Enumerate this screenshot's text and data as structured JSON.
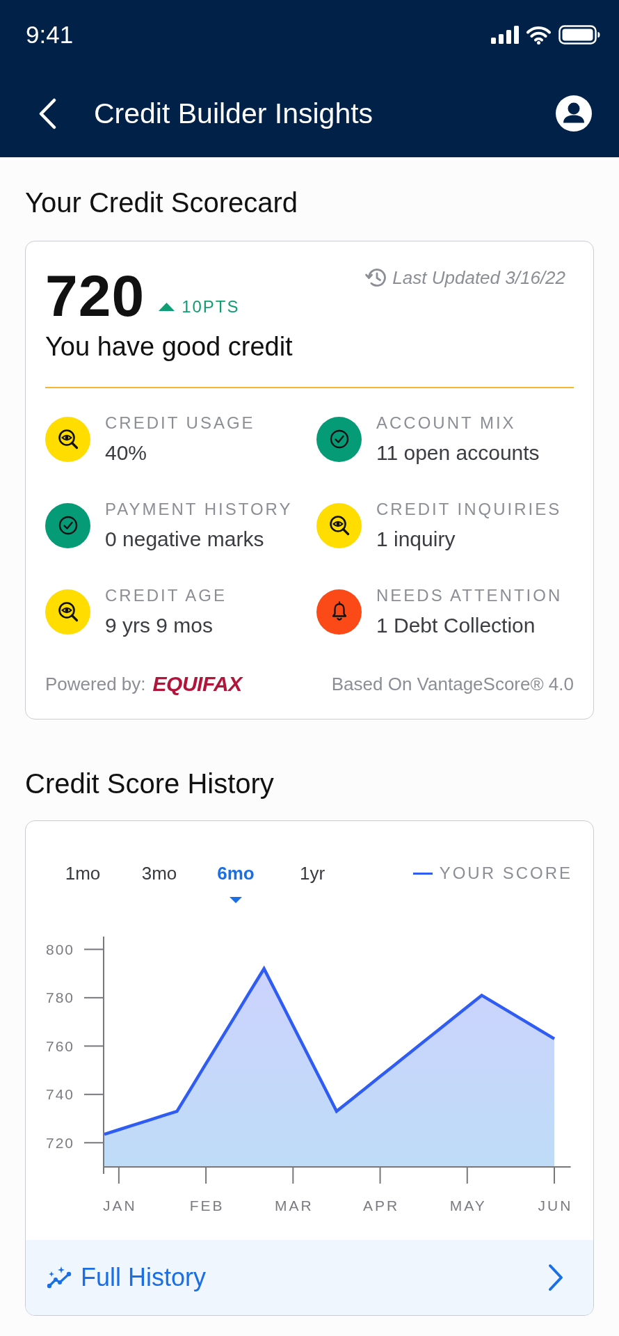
{
  "status_bar": {
    "time": "9:41"
  },
  "app_bar": {
    "title": "Credit Builder Insights"
  },
  "scorecard": {
    "heading": "Your Credit Scorecard",
    "score": "720",
    "score_change": "10PTS",
    "last_updated": "Last Updated 3/16/22",
    "rating": "You have good credit",
    "metrics": [
      {
        "kind": "review",
        "color": "#ffdd00",
        "label": "CREDIT USAGE",
        "value": "40%"
      },
      {
        "kind": "good",
        "color": "#069b77",
        "label": "ACCOUNT MIX",
        "value": "11 open accounts"
      },
      {
        "kind": "good",
        "color": "#069b77",
        "label": "PAYMENT HISTORY",
        "value": "0 negative marks"
      },
      {
        "kind": "review",
        "color": "#ffdd00",
        "label": "CREDIT INQUIRIES",
        "value": "1 inquiry"
      },
      {
        "kind": "review",
        "color": "#ffdd00",
        "label": "CREDIT AGE",
        "value": "9 yrs 9 mos"
      },
      {
        "kind": "alert",
        "color": "#fb4a17",
        "label": "NEEDS ATTENTION",
        "value": "1 Debt Collection"
      }
    ],
    "powered_by": {
      "label": "Powered by:",
      "logo": "EQUIFAX"
    },
    "model": "Based On VantageScore® 4.0"
  },
  "history": {
    "heading": "Credit Score History",
    "tabs": [
      {
        "label": "1mo",
        "selected": false
      },
      {
        "label": "3mo",
        "selected": false
      },
      {
        "label": "6mo",
        "selected": true
      },
      {
        "label": "1yr",
        "selected": false
      }
    ],
    "chart_data": {
      "type": "area",
      "categories": [
        null,
        "JAN",
        null,
        null,
        null,
        null,
        null,
        "FEB",
        null,
        null,
        null,
        null,
        null,
        "MAR",
        null,
        null,
        null,
        null,
        null,
        "APR",
        null,
        null,
        null,
        null,
        null,
        "MAY",
        null,
        null,
        null,
        null,
        null,
        "JUN"
      ],
      "series": [
        {
          "name": "YOUR SCORE",
          "color": "#2f5cf3",
          "values": [
            723.5,
            725.4,
            727.3,
            729.2,
            731.1,
            733,
            742.8,
            752.7,
            762.5,
            772.3,
            782.2,
            792,
            780.2,
            768.4,
            756.6,
            744.8,
            733,
            737.8,
            742.6,
            747.4,
            752.2,
            757,
            761.8,
            766.6,
            771.4,
            776.2,
            781,
            777.4,
            773.8,
            770.2,
            766.6,
            763
          ]
        }
      ],
      "ylim": [
        710,
        805
      ],
      "yticks": [
        720,
        740,
        760,
        780,
        800
      ]
    },
    "link": "Full History"
  }
}
